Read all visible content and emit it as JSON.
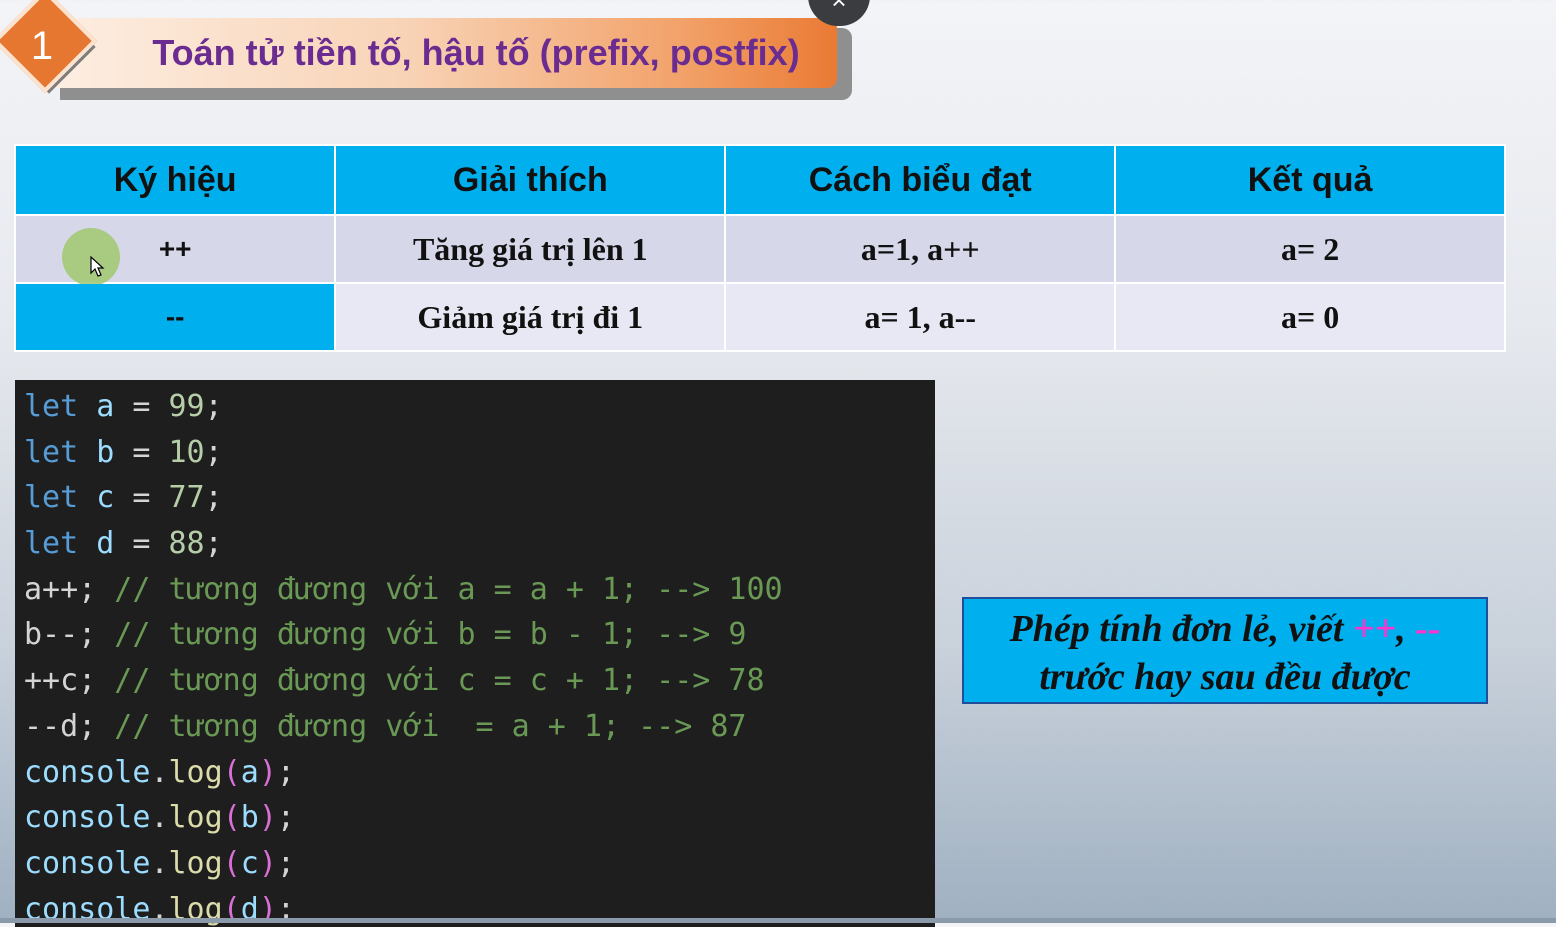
{
  "header": {
    "badge_number": "1",
    "title": "Toán tử tiền tố, hậu tố (prefix, postfix)",
    "close_label": "×"
  },
  "table": {
    "columns": [
      "Ký hiệu",
      "Giải thích",
      "Cách biểu đạt",
      "Kết quả"
    ],
    "rows": [
      [
        "++",
        "Tăng giá trị lên 1",
        "a=1, a++",
        "a= 2"
      ],
      [
        "--",
        "Giảm giá trị đi 1",
        "a= 1, a--",
        "a= 0"
      ]
    ]
  },
  "code": {
    "lines": [
      {
        "kw": "let",
        "var": "a",
        "rest": " = ",
        "num": "99",
        "end": ";"
      },
      {
        "kw": "let",
        "var": "b",
        "rest": " = ",
        "num": "10",
        "end": ";"
      },
      {
        "kw": "let",
        "var": "c",
        "rest": " = ",
        "num": "77",
        "end": ";"
      },
      {
        "kw": "let",
        "var": "d",
        "rest": " = ",
        "num": "88",
        "end": ";"
      },
      {
        "stmt": "a++;",
        "comment": " // tương đương với a = a + 1; --> 100"
      },
      {
        "stmt": "b--;",
        "comment": " // tương đương với b = b - 1; --> 9"
      },
      {
        "stmt": "++c;",
        "comment": " // tương đương với c = c + 1; --> 78"
      },
      {
        "stmt": "--d;",
        "comment": " // tương đương với  = a + 1; --> 87"
      },
      {
        "obj": "console",
        "fn": "log",
        "arg": "a"
      },
      {
        "obj": "console",
        "fn": "log",
        "arg": "b"
      },
      {
        "obj": "console",
        "fn": "log",
        "arg": "c"
      },
      {
        "obj": "console",
        "fn": "log",
        "arg": "d"
      }
    ]
  },
  "note": {
    "text_before": "Phép tính đơn lẻ, viết ",
    "op1": "++",
    "comma": ", ",
    "op2": "--",
    "text_after": "trước hay sau đều được"
  },
  "colors": {
    "table_header": "#00b0ee",
    "banner_title": "#6b2c91",
    "badge": "#e57730",
    "note_operator": "#ff33cc"
  },
  "icons": [
    "close-icon",
    "mouse-cursor-icon"
  ]
}
